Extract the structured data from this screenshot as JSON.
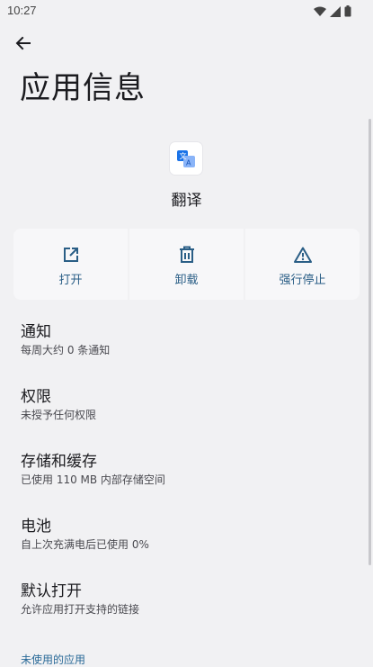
{
  "status_bar": {
    "time": "10:27",
    "icons": [
      "wifi-icon",
      "cellular-signal-icon",
      "battery-icon"
    ]
  },
  "header": {
    "back_icon": "arrow-left-icon",
    "title": "应用信息"
  },
  "app": {
    "icon": "translate-app-icon",
    "name": "翻译"
  },
  "actions": [
    {
      "label": "打开",
      "icon": "open-external-icon"
    },
    {
      "label": "卸载",
      "icon": "trash-icon"
    },
    {
      "label": "强行停止",
      "icon": "warning-icon"
    }
  ],
  "settings": [
    {
      "title": "通知",
      "subtitle": "每周大约 0 条通知"
    },
    {
      "title": "权限",
      "subtitle": "未授予任何权限"
    },
    {
      "title": "存储和缓存",
      "subtitle": "已使用 110 MB 内部存储空间"
    },
    {
      "title": "电池",
      "subtitle": "自上次充满电后已使用 0%"
    },
    {
      "title": "默认打开",
      "subtitle": "允许应用打开支持的链接"
    }
  ],
  "section": {
    "unused_apps": "未使用的应用"
  },
  "colors": {
    "background": "#f1f1f3",
    "accent": "#2a5e86",
    "card": "#f7f7f9"
  }
}
